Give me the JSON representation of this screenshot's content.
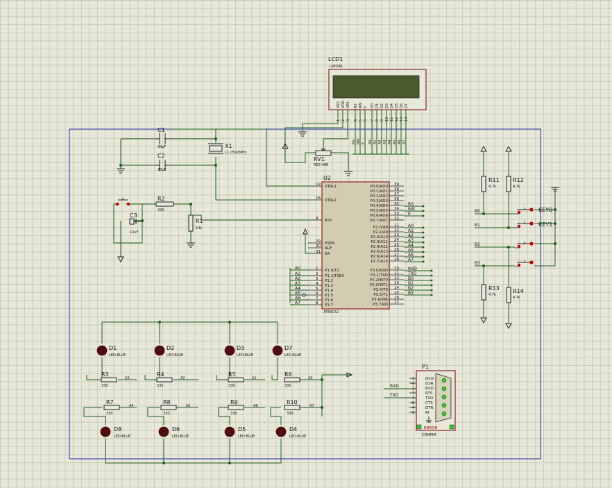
{
  "lcd": {
    "ref": "LCD1",
    "part": "LM016L",
    "pins": [
      "VSS",
      "VDD",
      "VEE",
      "RS",
      "RW",
      "E",
      "D0",
      "D1",
      "D2",
      "D3",
      "D4",
      "D5",
      "D6",
      "D7"
    ],
    "pin_numbers": [
      "1",
      "2",
      "3",
      "4",
      "5",
      "6",
      "7",
      "8",
      "9",
      "10",
      "11",
      "12",
      "13",
      "14"
    ]
  },
  "mcu": {
    "ref": "U2",
    "part": "AT89C52",
    "left_pins": [
      {
        "name": "XTAL1",
        "num": "19"
      },
      {
        "name": "XTAL2",
        "num": "18"
      },
      {
        "name": "RST",
        "num": "9"
      },
      {
        "name": "PSEN",
        "num": "29"
      },
      {
        "name": "ALE",
        "num": "30"
      },
      {
        "name": "EA",
        "num": "31"
      },
      {
        "name": "P1.0/T2",
        "num": "1"
      },
      {
        "name": "P1.1/T2EX",
        "num": "2"
      },
      {
        "name": "P1.2",
        "num": "3"
      },
      {
        "name": "P1.3",
        "num": "4"
      },
      {
        "name": "P1.4",
        "num": "5"
      },
      {
        "name": "P1.5",
        "num": "6"
      },
      {
        "name": "P1.6",
        "num": "7"
      },
      {
        "name": "P1.7",
        "num": "8"
      }
    ],
    "right_pins": [
      {
        "name": "P0.0/AD0",
        "num": "39"
      },
      {
        "name": "P0.1/AD1",
        "num": "38"
      },
      {
        "name": "P0.2/AD2",
        "num": "37"
      },
      {
        "name": "P0.3/AD3",
        "num": "36"
      },
      {
        "name": "P0.4/AD4",
        "num": "35"
      },
      {
        "name": "P0.5/AD5",
        "num": "34"
      },
      {
        "name": "P0.6/AD6",
        "num": "33"
      },
      {
        "name": "P0.7/AD7",
        "num": "32"
      },
      {
        "name": "P2.0/A8",
        "num": "21"
      },
      {
        "name": "P2.1/A9",
        "num": "22"
      },
      {
        "name": "P2.2/A10",
        "num": "23"
      },
      {
        "name": "P2.3/A11",
        "num": "24"
      },
      {
        "name": "P2.4/A12",
        "num": "25"
      },
      {
        "name": "P2.5/A13",
        "num": "26"
      },
      {
        "name": "P2.6/A14",
        "num": "27"
      },
      {
        "name": "P2.7/A15",
        "num": "28"
      },
      {
        "name": "P3.0/RXD",
        "num": "10"
      },
      {
        "name": "P3.1/TXD",
        "num": "11"
      },
      {
        "name": "P3.2/INT0",
        "num": "12"
      },
      {
        "name": "P3.3/INT1",
        "num": "13"
      },
      {
        "name": "P3.4/T0",
        "num": "14"
      },
      {
        "name": "P3.5/T1",
        "num": "15"
      },
      {
        "name": "P3.6/WR",
        "num": "16"
      },
      {
        "name": "P3.7/RD",
        "num": "17"
      }
    ]
  },
  "components": {
    "c1": {
      "ref": "C1",
      "value": "30pF"
    },
    "c2": {
      "ref": "C2",
      "value": "30pF"
    },
    "c3": {
      "ref": "C3",
      "value": "10uF"
    },
    "x1": {
      "ref": "X1",
      "value": "11.0592MHz"
    },
    "r1": {
      "ref": "R1",
      "value": "10k"
    },
    "r2": {
      "ref": "R2",
      "value": "220"
    },
    "rv1": {
      "ref": "RV1",
      "value": "RES-VAR"
    },
    "r11": {
      "ref": "R11",
      "value": "4.7k"
    },
    "r12": {
      "ref": "R12",
      "value": "4.7k"
    },
    "r13": {
      "ref": "R13",
      "value": "4.7k"
    },
    "r14": {
      "ref": "R14",
      "value": "4.7k"
    },
    "key0": {
      "ref": "KEY0"
    },
    "key1": {
      "ref": "KEY1"
    },
    "p1": {
      "ref": "P1",
      "part": "COMPIM",
      "status": "ERROR",
      "pins": [
        "DCD",
        "DSR",
        "RXD",
        "RTS",
        "TXD",
        "CTS",
        "DTR",
        "RI"
      ],
      "pin_numbers": [
        "1",
        "6",
        "2",
        "7",
        "3",
        "8",
        "4",
        "9"
      ]
    }
  },
  "leds_top": [
    {
      "ref": "D1",
      "part": "LED-BLUE"
    },
    {
      "ref": "D2",
      "part": "LED-BLUE"
    },
    {
      "ref": "D3",
      "part": "LED-BLUE"
    },
    {
      "ref": "D7",
      "part": "LED-BLUE"
    }
  ],
  "leds_bottom": [
    {
      "ref": "D8",
      "part": "LED-BLUE"
    },
    {
      "ref": "D6",
      "part": "LED-BLUE"
    },
    {
      "ref": "D5",
      "part": "LED-BLUE"
    },
    {
      "ref": "D4",
      "part": "LED-BLUE"
    }
  ],
  "res_top": [
    {
      "ref": "R3",
      "value": "330",
      "net": "A3"
    },
    {
      "ref": "R4",
      "value": "330",
      "net": "A2"
    },
    {
      "ref": "R5",
      "value": "330",
      "net": "A1"
    },
    {
      "ref": "R6",
      "value": "330",
      "net": "A0"
    }
  ],
  "res_bottom": [
    {
      "ref": "R7",
      "value": "330",
      "net": "A4"
    },
    {
      "ref": "R8",
      "value": "330",
      "net": "A5"
    },
    {
      "ref": "R9",
      "value": "330",
      "net": "A6"
    },
    {
      "ref": "R10",
      "value": "330",
      "net": "A7"
    }
  ],
  "nets": {
    "lcd_bus": [
      "RS",
      "RW",
      "E",
      "A0",
      "A1",
      "A2",
      "A3",
      "A4",
      "A5",
      "A6",
      "A7"
    ],
    "p0_labels": [
      "RS",
      "RW",
      "E"
    ],
    "p2_labels": [
      "A0",
      "A1",
      "A2",
      "A3",
      "A4",
      "A5",
      "A6",
      "A7"
    ],
    "p1_labels": [
      "A0",
      "A1",
      "A2",
      "A3",
      "A4",
      "A5",
      "A6",
      "A7"
    ],
    "p3_labels": [
      "RXD",
      "TXD",
      "B0",
      "B1",
      "B2",
      "B3"
    ],
    "key_labels": [
      "B0",
      "B1",
      "B2",
      "B3"
    ],
    "com_labels": [
      "RXD",
      "TXD"
    ]
  }
}
